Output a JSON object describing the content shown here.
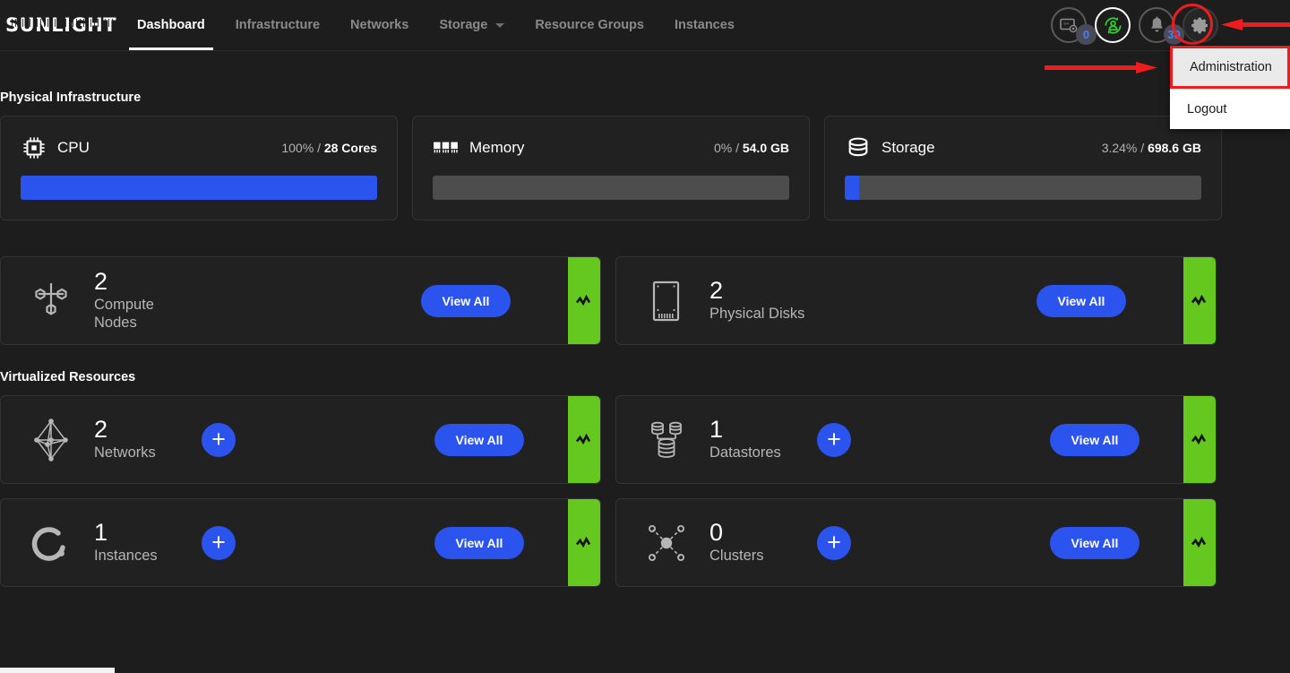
{
  "brand": {
    "logo_text": "SUNLIGHT"
  },
  "nav": {
    "items": [
      {
        "label": "Dashboard",
        "active": true,
        "caret": false
      },
      {
        "label": "Infrastructure",
        "active": false,
        "caret": false
      },
      {
        "label": "Networks",
        "active": false,
        "caret": false
      },
      {
        "label": "Storage",
        "active": false,
        "caret": true
      },
      {
        "label": "Resource Groups",
        "active": false,
        "caret": false
      },
      {
        "label": "Instances",
        "active": false,
        "caret": false
      }
    ]
  },
  "nav_right": {
    "vm_console": {
      "icon": "vm-console-icon",
      "badge": "0"
    },
    "sync": {
      "icon": "sync-user-icon",
      "badge": ""
    },
    "notifications": {
      "icon": "bell-icon",
      "badge": "30"
    },
    "settings": {
      "icon": "gear-icon"
    }
  },
  "dropdown": {
    "items": [
      {
        "label": "Administration",
        "highlighted": true
      },
      {
        "label": "Logout",
        "highlighted": false
      }
    ]
  },
  "sections": {
    "physical_title": "Physical Infrastructure",
    "virtual_title": "Virtualized Resources"
  },
  "capacity": [
    {
      "name": "CPU",
      "icon": "cpu-icon",
      "percent": "100%",
      "total": "28 Cores",
      "fill": 100
    },
    {
      "name": "Memory",
      "icon": "memory-icon",
      "percent": "0%",
      "total": "54.0 GB",
      "fill": 0
    },
    {
      "name": "Storage",
      "icon": "storage-icon",
      "percent": "3.24%",
      "total": "698.6 GB",
      "fill": 4
    }
  ],
  "physical_resources": [
    {
      "count": "2",
      "label": "Compute\nNodes",
      "icon": "compute-nodes-icon",
      "add": false,
      "view_all": "View All",
      "status": "healthy"
    },
    {
      "count": "2",
      "label": "Physical Disks",
      "icon": "physical-disk-icon",
      "add": false,
      "view_all": "View All",
      "status": "healthy"
    }
  ],
  "virtual_resources": [
    {
      "count": "2",
      "label": "Networks",
      "icon": "networks-icon",
      "add": true,
      "view_all": "View All",
      "status": "healthy"
    },
    {
      "count": "1",
      "label": "Datastores",
      "icon": "datastores-icon",
      "add": true,
      "view_all": "View All",
      "status": "healthy"
    },
    {
      "count": "1",
      "label": "Instances",
      "icon": "instances-icon",
      "add": true,
      "view_all": "View All",
      "status": "healthy"
    },
    {
      "count": "0",
      "label": "Clusters",
      "icon": "clusters-icon",
      "add": true,
      "view_all": "View All",
      "status": "healthy"
    }
  ],
  "colors": {
    "accent_blue": "#2b54ef",
    "status_green": "#64c81e",
    "highlight_red": "#ee1c1c",
    "page_bg": "#1d1d1d",
    "card_bg": "#212121"
  },
  "plus_label": "+"
}
